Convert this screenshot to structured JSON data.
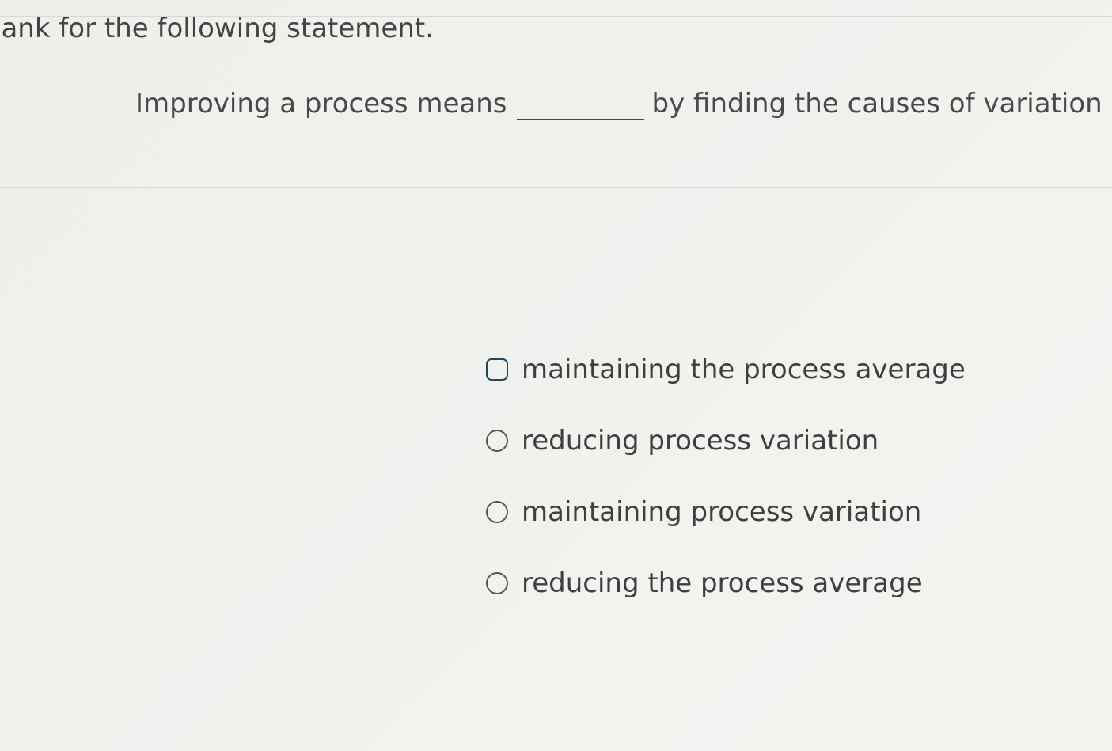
{
  "question": {
    "instruction": "lank for the following statement.",
    "statement_before": "Improving a process means",
    "statement_after": "by finding the causes of variation and elim"
  },
  "options": [
    {
      "label": "maintaining the process average"
    },
    {
      "label": "reducing process variation"
    },
    {
      "label": "maintaining process variation"
    },
    {
      "label": "reducing the process average"
    }
  ]
}
